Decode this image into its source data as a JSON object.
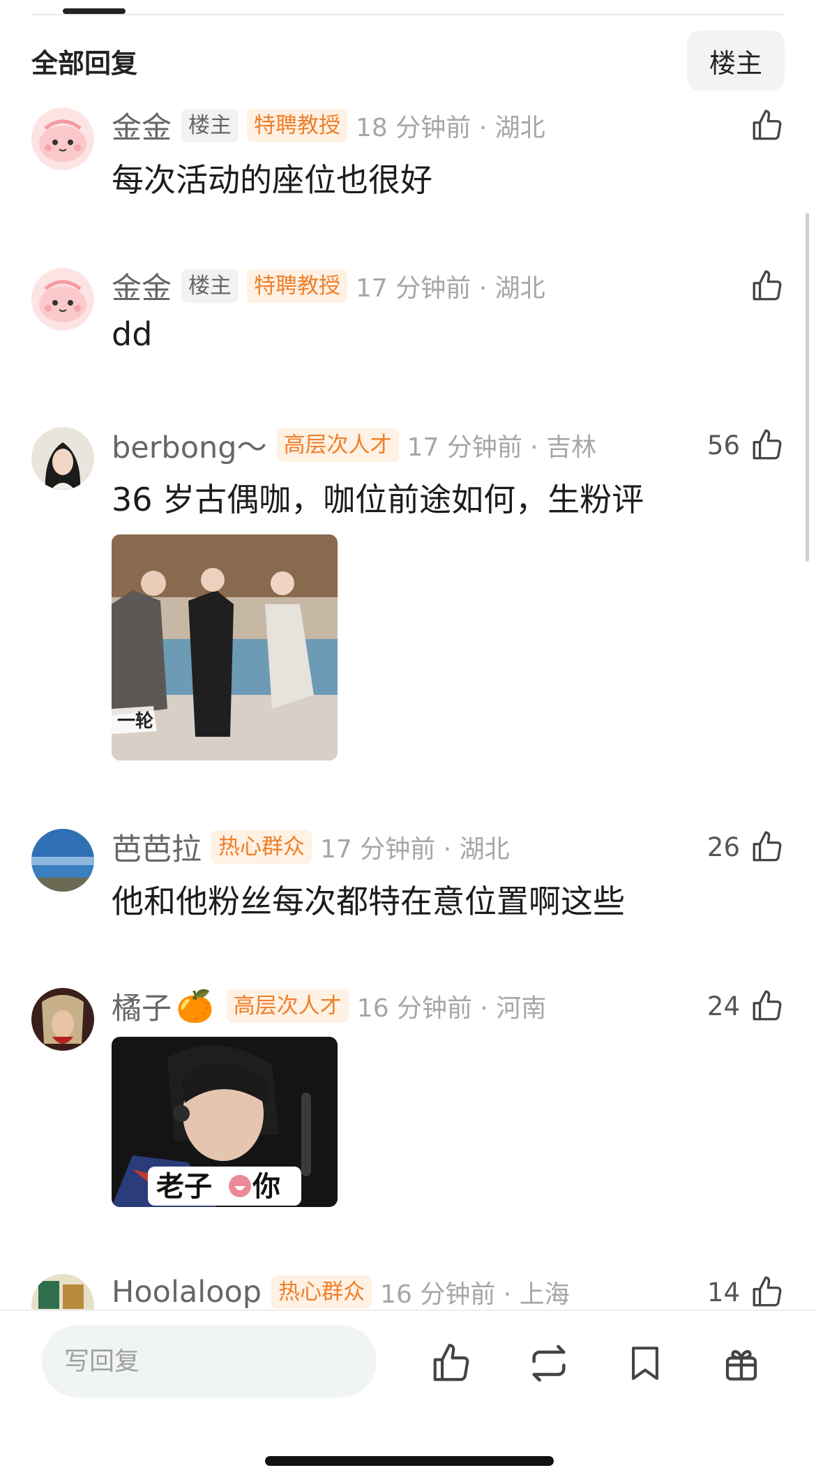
{
  "header": {
    "title": "全部回复",
    "filter_label": "楼主"
  },
  "comments": [
    {
      "username": "金金",
      "badges": [
        "楼主",
        "特聘教授"
      ],
      "time": "18 分钟前 · 湖北",
      "likes": "",
      "text": "每次活动的座位也很好"
    },
    {
      "username": "金金",
      "badges": [
        "楼主",
        "特聘教授"
      ],
      "time": "17 分钟前 · 湖北",
      "likes": "",
      "text": "dd"
    },
    {
      "username": "berbong～",
      "badges": [
        "高层次人才"
      ],
      "time": "17 分钟前 · 吉林",
      "likes": "56",
      "text": "36 岁古偶咖，咖位前途如何，生粉评"
    },
    {
      "username": "芭芭拉",
      "badges": [
        "热心群众"
      ],
      "time": "17 分钟前 · 湖北",
      "likes": "26",
      "text": "他和他粉丝每次都特在意位置啊这些"
    },
    {
      "username": "橘子",
      "emoji": "🍊",
      "badges": [
        "高层次人才"
      ],
      "time": "16 分钟前 · 河南",
      "likes": "24",
      "text": "",
      "image_caption": "老子",
      "image_caption_end": "你"
    },
    {
      "username": "Hoolaloop",
      "badges": [
        "热心群众"
      ],
      "time": "16 分钟前 · 上海",
      "likes": "14",
      "text": ""
    }
  ],
  "image1_caption": "一轮",
  "bottom_bar": {
    "reply_placeholder": "写回复",
    "actions": [
      "like-icon",
      "repost-icon",
      "bookmark-icon",
      "gift-icon"
    ]
  },
  "colors": {
    "badge_orange": "#ee7f2b",
    "badge_orange_bg": "#fff1e3",
    "time_gray": "#a6a6a6"
  }
}
